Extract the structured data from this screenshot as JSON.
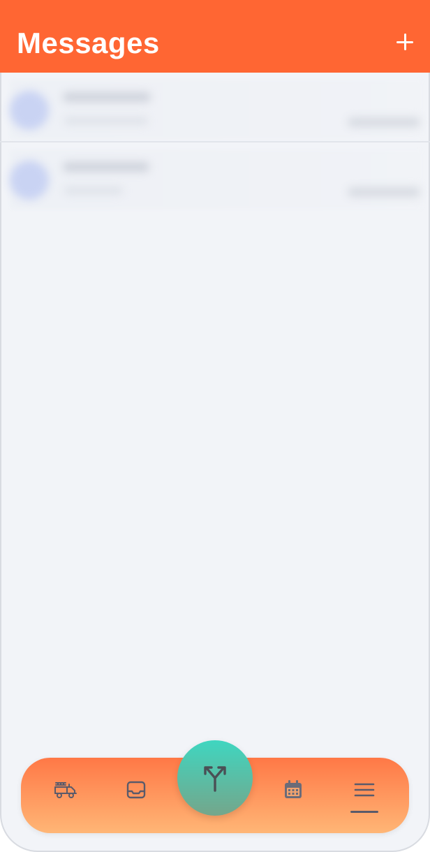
{
  "header": {
    "title": "Messages",
    "add_button_icon": "plus-icon"
  },
  "messages": [
    {
      "avatar_icon": "avatar",
      "name": "",
      "preview": "",
      "time": ""
    },
    {
      "avatar_icon": "avatar",
      "name": "",
      "preview": "",
      "time": ""
    }
  ],
  "tabbar": {
    "items": [
      {
        "icon": "fire-truck-icon",
        "active": false
      },
      {
        "icon": "inbox-icon",
        "active": false
      },
      {
        "icon": "split-arrow-icon",
        "active": false,
        "center": true
      },
      {
        "icon": "calendar-icon",
        "active": false
      },
      {
        "icon": "menu-icon",
        "active": true
      }
    ]
  },
  "colors": {
    "header": "#ff6633",
    "background": "#f2f4f8",
    "tabbar_top": "#ff7846",
    "tabbar_bottom": "#ffb676",
    "fab_top": "#3fd6c0",
    "fab_bottom": "#74a68b",
    "icon": "#5a5a6a"
  }
}
